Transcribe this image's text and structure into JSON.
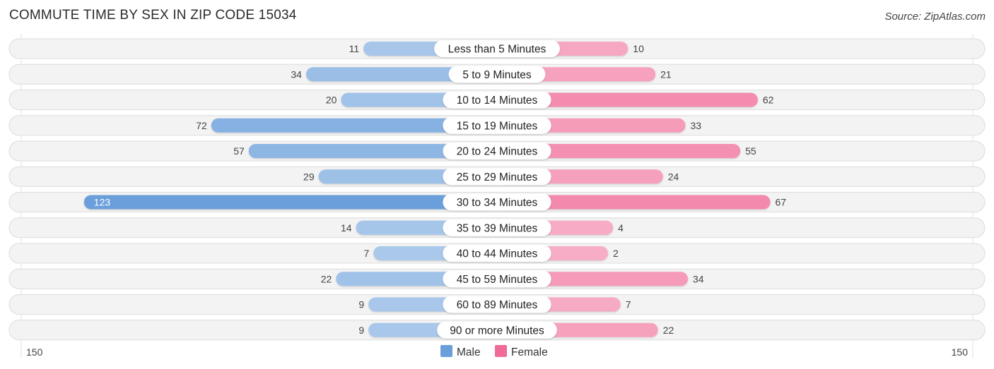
{
  "header": {
    "title": "COMMUTE TIME BY SEX IN ZIP CODE 15034",
    "source": "Source: ZipAtlas.com"
  },
  "chart_data": {
    "type": "bar",
    "orientation": "horizontal-diverging",
    "title": "COMMUTE TIME BY SEX IN ZIP CODE 15034",
    "categories": [
      "Less than 5 Minutes",
      "5 to 9 Minutes",
      "10 to 14 Minutes",
      "15 to 19 Minutes",
      "20 to 24 Minutes",
      "25 to 29 Minutes",
      "30 to 34 Minutes",
      "35 to 39 Minutes",
      "40 to 44 Minutes",
      "45 to 59 Minutes",
      "60 to 89 Minutes",
      "90 or more Minutes"
    ],
    "series": [
      {
        "name": "Male",
        "color": "#6a9fdb",
        "side": "left",
        "values": [
          11,
          34,
          20,
          72,
          57,
          29,
          123,
          14,
          7,
          22,
          9,
          9
        ]
      },
      {
        "name": "Female",
        "color": "#f06b97",
        "side": "right",
        "values": [
          10,
          21,
          62,
          33,
          55,
          24,
          67,
          4,
          2,
          34,
          7,
          22
        ]
      }
    ],
    "axis": {
      "left_label": "150",
      "right_label": "150",
      "max": 150
    },
    "legend": {
      "position": "bottom-center",
      "items": [
        "Male",
        "Female"
      ]
    },
    "xlabel": "",
    "ylabel": ""
  }
}
